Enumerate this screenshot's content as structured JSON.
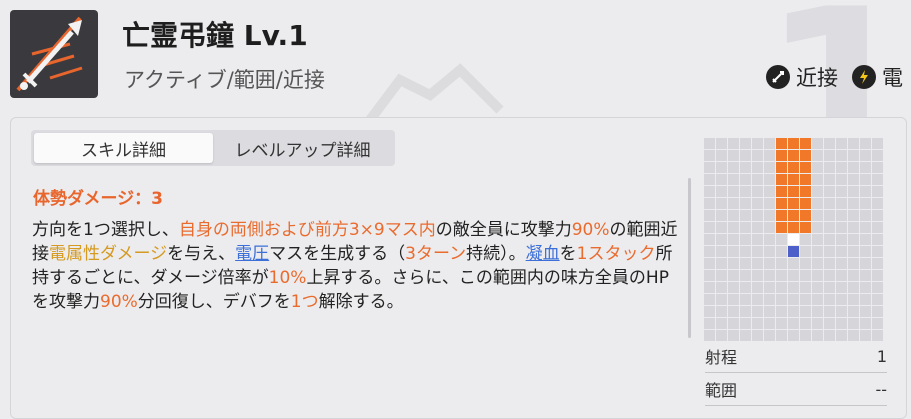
{
  "skill": {
    "title": "亡霊弔鐘 Lv.1",
    "subtitle": "アクティブ/範囲/近接",
    "tags": [
      {
        "label": "近接",
        "icon": "sword-icon"
      },
      {
        "label": "電",
        "icon": "lightning-icon"
      }
    ]
  },
  "tabs": [
    "スキル詳細",
    "レベルアップ詳細"
  ],
  "detail": {
    "stance": "体勢ダメージ：3",
    "segments": [
      {
        "t": "方向を1つ選択し、",
        "c": ""
      },
      {
        "t": "自身の両側および前方3×9マス内",
        "c": "o"
      },
      {
        "t": "の敵全員に攻撃力",
        "c": ""
      },
      {
        "t": "90%",
        "c": "o"
      },
      {
        "t": "の範囲近接",
        "c": ""
      },
      {
        "t": "電属性ダメージ",
        "c": "y"
      },
      {
        "t": "を与え、",
        "c": ""
      },
      {
        "t": "電圧",
        "c": "b"
      },
      {
        "t": "マスを生成する（",
        "c": ""
      },
      {
        "t": "3ターン",
        "c": "o"
      },
      {
        "t": "持続）。",
        "c": ""
      },
      {
        "t": "凝血",
        "c": "b"
      },
      {
        "t": "を",
        "c": ""
      },
      {
        "t": "1スタック",
        "c": "o"
      },
      {
        "t": "所持するごとに、ダメージ倍率が",
        "c": ""
      },
      {
        "t": "10%",
        "c": "o"
      },
      {
        "t": "上昇する。さらに、この範囲内の味方全員のHPを攻撃力",
        "c": ""
      },
      {
        "t": "90%",
        "c": "o"
      },
      {
        "t": "分回復し、デバフを",
        "c": ""
      },
      {
        "t": "1つ",
        "c": "o"
      },
      {
        "t": "解除する。",
        "c": ""
      }
    ]
  },
  "colors": {
    "accent": "#ea6b2e",
    "gold": "#d59a22",
    "link": "#3c6fd8",
    "player": "#4d5fc9"
  },
  "range_grid": {
    "cols": 15,
    "rows": 17,
    "hit_cols": [
      6,
      7,
      8
    ],
    "hit_rows_from": 0,
    "hit_rows_to": 7,
    "self_cell": [
      7,
      8
    ],
    "player_cell": [
      7,
      9
    ]
  },
  "stats": [
    {
      "label": "射程",
      "value": "1"
    },
    {
      "label": "範囲",
      "value": "--"
    }
  ]
}
